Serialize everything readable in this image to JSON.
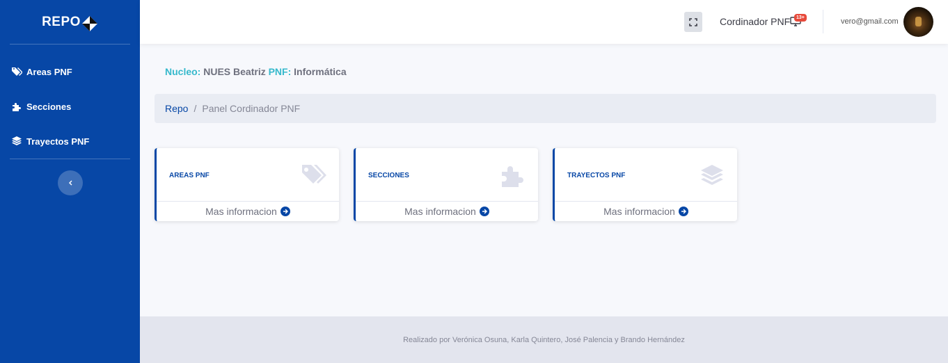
{
  "brand": {
    "name": "REPO"
  },
  "sidebar": {
    "items": [
      {
        "label": "Areas PNF",
        "icon": "tags-icon"
      },
      {
        "label": "Secciones",
        "icon": "puzzle-icon"
      },
      {
        "label": "Trayectos PNF",
        "icon": "layers-icon"
      }
    ]
  },
  "topbar": {
    "role": "Cordinador PNF",
    "badge": "13+",
    "email": "vero@gmail.com"
  },
  "info": {
    "nucleo_key": "Nucleo:",
    "nucleo_value": "NUES Beatriz",
    "pnf_key": "PNF:",
    "pnf_value": "Informática"
  },
  "breadcrumb": {
    "root": "Repo",
    "separator": "/",
    "current": "Panel Cordinador PNF"
  },
  "cards": [
    {
      "title": "AREAS PNF",
      "link": "Mas informacion",
      "icon": "tags-icon"
    },
    {
      "title": "SECCIONES",
      "link": "Mas informacion",
      "icon": "puzzle-icon"
    },
    {
      "title": "TRAYECTOS PNF",
      "link": "Mas informacion",
      "icon": "layers-icon"
    }
  ],
  "footer": {
    "credits": "Realizado por Verónica Osuna, Karla Quintero, José Palencia y Brando Hernández"
  },
  "colors": {
    "primary": "#0747a6",
    "info": "#36b9cc",
    "danger": "#e74a3b"
  }
}
